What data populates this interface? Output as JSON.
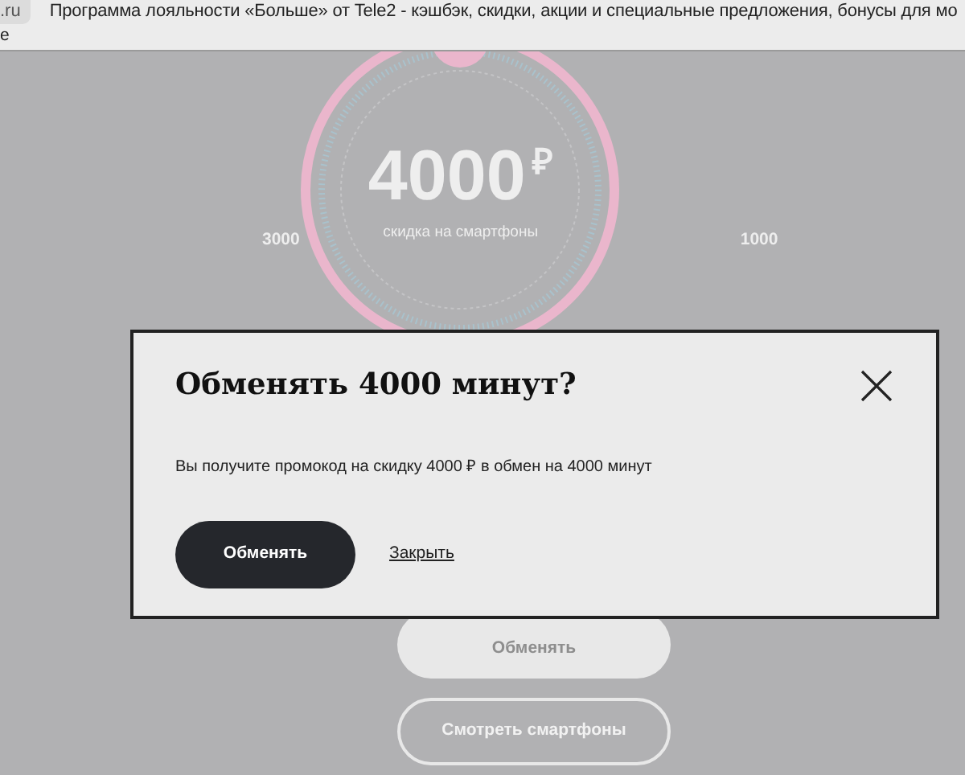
{
  "browser": {
    "tab_label": ".ru",
    "page_title": "Программа лояльности «Больше» от Tele2 - кэшбэк, скидки, акции и специальные предложения, бонусы для мо",
    "second_line": "e"
  },
  "dial": {
    "amount": "4000",
    "currency": "₽",
    "caption": "скидка на смартфоны",
    "left_label": "3000",
    "right_label": "1000"
  },
  "page_buttons": [
    {
      "label": "Обменять",
      "kind": "filled"
    },
    {
      "label": "Смотреть смартфоны",
      "kind": "outline"
    }
  ],
  "dialog": {
    "title": "Обменять 4000 минут?",
    "message": "Вы получите промокод на скидку 4000 ₽ в обмен на 4000 минут",
    "confirm": "Обменять",
    "close_link": "Закрыть"
  }
}
